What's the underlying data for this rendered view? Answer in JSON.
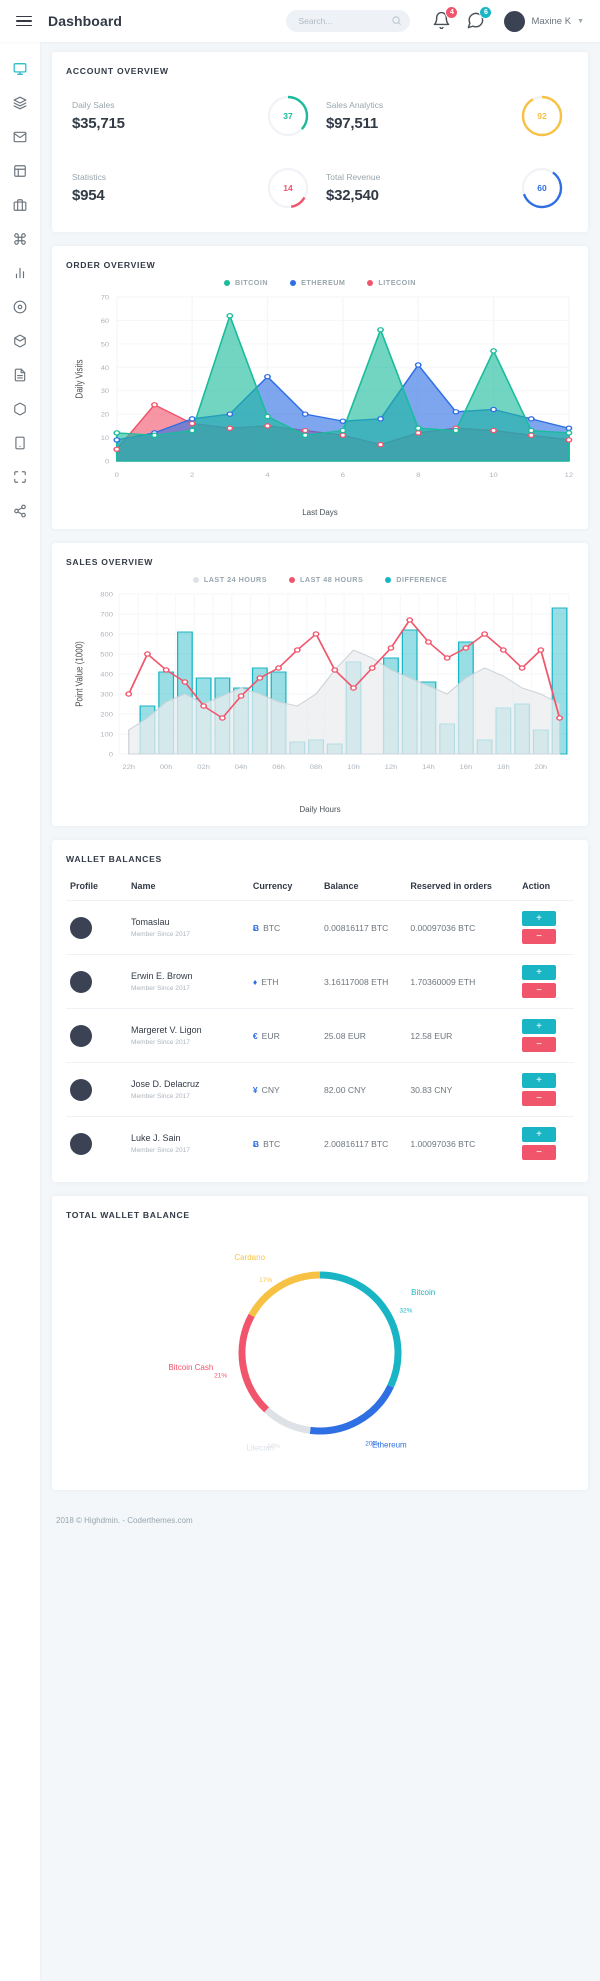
{
  "topbar": {
    "menu_icon": "hamburger-icon",
    "title": "Dashboard",
    "search": {
      "placeholder": "Search...",
      "value": "",
      "icon": "search-icon"
    },
    "notifications": {
      "icon": "bell-icon",
      "count": "4",
      "color": "#f1556c"
    },
    "messages": {
      "icon": "chat-icon",
      "count": "6",
      "color": "#1ab5c4"
    },
    "user": {
      "name": "Maxine K",
      "caret": "⌄",
      "avatar": "avatar"
    }
  },
  "sidebar": {
    "items": [
      {
        "icon": "monitor-icon",
        "name": "dashboard",
        "active": true
      },
      {
        "icon": "layers-icon",
        "name": "layouts",
        "active": false
      },
      {
        "icon": "mail-icon",
        "name": "email",
        "active": false
      },
      {
        "icon": "layout-icon",
        "name": "pages",
        "active": false
      },
      {
        "icon": "briefcase-icon",
        "name": "projects",
        "active": false
      },
      {
        "icon": "command-icon",
        "name": "ui-kit",
        "active": false
      },
      {
        "icon": "chart-icon",
        "name": "charts",
        "active": false
      },
      {
        "icon": "target-icon",
        "name": "icons",
        "active": false
      },
      {
        "icon": "box-icon",
        "name": "components",
        "active": false
      },
      {
        "icon": "file-text-icon",
        "name": "forms",
        "active": false
      },
      {
        "icon": "hexagon-icon",
        "name": "extras",
        "active": false
      },
      {
        "icon": "smartphone-icon",
        "name": "mobile",
        "active": false
      },
      {
        "icon": "maximize-icon",
        "name": "widgets",
        "active": false
      },
      {
        "icon": "share-icon",
        "name": "multi-level",
        "active": false
      }
    ]
  },
  "account_overview": {
    "title": "Account Overview",
    "stats": [
      {
        "label": "Daily Sales",
        "value": "$35,715",
        "ring_value": "37",
        "ring_pct": 37,
        "color": "#1abc9c"
      },
      {
        "label": "Sales Analytics",
        "value": "$97,511",
        "ring_value": "92",
        "ring_pct": 92,
        "color": "#f7c244"
      },
      {
        "label": "Statistics",
        "value": "$954",
        "ring_value": "14",
        "ring_pct": 14,
        "color": "#f1556c"
      },
      {
        "label": "Total Revenue",
        "value": "$32,540",
        "ring_value": "60",
        "ring_pct": 60,
        "color": "#2f6fe4"
      }
    ]
  },
  "order_overview": {
    "title": "Order Overview"
  },
  "sales_overview": {
    "title": "Sales Overview"
  },
  "wallet_balances": {
    "title": "Wallet Balances",
    "columns": [
      "Profile",
      "Name",
      "Currency",
      "Balance",
      "Reserved in orders",
      "Action"
    ],
    "add_label": "+",
    "remove_label": "−",
    "rows": [
      {
        "name": "Tomaslau",
        "meta": "Member Since 2017",
        "cur_symbol": "Ƀ",
        "cur_color": "#2f6fe4",
        "currency": "BTC",
        "balance": "0.00816117 BTC",
        "reserved": "0.00097036 BTC"
      },
      {
        "name": "Erwin E. Brown",
        "meta": "Member Since 2017",
        "cur_symbol": "♦",
        "cur_color": "#2f6fe4",
        "currency": "ETH",
        "balance": "3.16117008 ETH",
        "reserved": "1.70360009 ETH"
      },
      {
        "name": "Margeret V. Ligon",
        "meta": "Member Since 2017",
        "cur_symbol": "€",
        "cur_color": "#2f6fe4",
        "currency": "EUR",
        "balance": "25.08 EUR",
        "reserved": "12.58 EUR"
      },
      {
        "name": "Jose D. Delacruz",
        "meta": "Member Since 2017",
        "cur_symbol": "¥",
        "cur_color": "#2f6fe4",
        "currency": "CNY",
        "balance": "82.00 CNY",
        "reserved": "30.83 CNY"
      },
      {
        "name": "Luke J. Sain",
        "meta": "Member Since 2017",
        "cur_symbol": "Ƀ",
        "cur_color": "#2f6fe4",
        "currency": "BTC",
        "balance": "2.00816117 BTC",
        "reserved": "1.00097036 BTC"
      }
    ]
  },
  "total_wallet_balance": {
    "title": "Total Wallet Balance"
  },
  "footer": {
    "text": "2018 © Highdmin. - Coderthemes.com"
  },
  "chart_data": [
    {
      "id": "order_overview",
      "type": "area",
      "title": "Order Overview",
      "xlabel": "Last Days",
      "ylabel": "Daily Visits",
      "xlim": [
        0,
        12
      ],
      "ylim": [
        0,
        70
      ],
      "xticks": [
        0,
        2,
        4,
        6,
        8,
        10,
        12
      ],
      "yticks": [
        0,
        10,
        20,
        30,
        40,
        50,
        60,
        70
      ],
      "grid": true,
      "legend_position": "top-right",
      "x": [
        0,
        1,
        2,
        3,
        4,
        5,
        6,
        7,
        8,
        9,
        10,
        11,
        12
      ],
      "series": [
        {
          "name": "BITCOIN",
          "color": "#1abc9c",
          "values": [
            12,
            11,
            13,
            62,
            19,
            11,
            13,
            56,
            14,
            13,
            47,
            13,
            12
          ]
        },
        {
          "name": "ETHEREUM",
          "color": "#2f6fe4",
          "values": [
            9,
            12,
            18,
            20,
            36,
            20,
            17,
            18,
            41,
            21,
            22,
            18,
            14
          ]
        },
        {
          "name": "LITECOIN",
          "color": "#f1556c",
          "values": [
            5,
            24,
            16,
            14,
            15,
            13,
            11,
            7,
            12,
            14,
            13,
            11,
            9
          ]
        }
      ]
    },
    {
      "id": "sales_overview",
      "type": "line-bar",
      "title": "Sales Overview",
      "xlabel": "Daily Hours",
      "ylabel": "Point Value (1000)",
      "xlim": [
        0,
        24
      ],
      "ylim": [
        0,
        800
      ],
      "yticks": [
        0,
        100,
        200,
        300,
        400,
        500,
        600,
        700,
        800
      ],
      "xticks": [
        "22h",
        "00h",
        "02h",
        "04h",
        "06h",
        "08h",
        "10h",
        "12h",
        "14h",
        "16h",
        "18h",
        "20h"
      ],
      "grid": true,
      "legend_position": "top-center",
      "series": [
        {
          "name": "LAST 24 HOURS",
          "color": "#dee2e6",
          "type": "area",
          "values": [
            120,
            180,
            260,
            300,
            250,
            290,
            330,
            300,
            260,
            240,
            300,
            420,
            520,
            480,
            420,
            380,
            340,
            300,
            380,
            430,
            390,
            330,
            300,
            250
          ]
        },
        {
          "name": "LAST 48 HOURS",
          "color": "#f1556c",
          "type": "line",
          "values": [
            300,
            500,
            420,
            360,
            240,
            180,
            290,
            380,
            430,
            520,
            600,
            420,
            330,
            430,
            530,
            670,
            560,
            480,
            530,
            600,
            520,
            430,
            520,
            180
          ]
        },
        {
          "name": "DIFFERENCE",
          "color": "#1ab5c4",
          "type": "bar",
          "values": [
            0,
            240,
            410,
            610,
            380,
            380,
            330,
            430,
            410,
            60,
            70,
            50,
            460,
            0,
            480,
            620,
            360,
            150,
            560,
            70,
            230,
            250,
            120,
            730
          ]
        }
      ]
    },
    {
      "id": "total_wallet_balance",
      "type": "pie",
      "title": "Total Wallet Balance",
      "labels": [
        "Bitcoin",
        "Ethereum",
        "Litecoin",
        "Bitcoin Cash",
        "Cardano"
      ],
      "values": [
        32,
        20,
        10,
        21,
        17
      ],
      "percent_labels": [
        "32%",
        "20%",
        "10%",
        "21%",
        "17%"
      ],
      "colors": [
        "#1ab5c4",
        "#2f6fe4",
        "#dee2e6",
        "#f1556c",
        "#f7c244"
      ]
    }
  ]
}
